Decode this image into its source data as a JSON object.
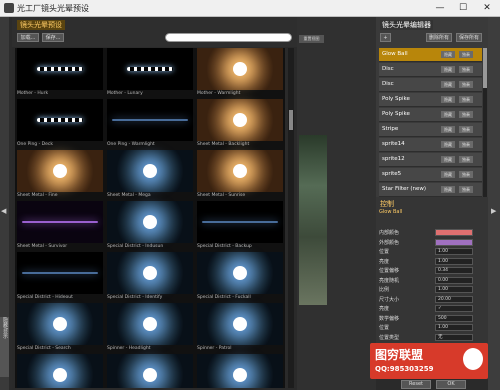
{
  "window": {
    "title": "光工厂镜头光晕预设",
    "min": "—",
    "max": "☐",
    "close": "✕"
  },
  "library": {
    "title": "镜头光晕预设",
    "buttons": [
      "加载...",
      "保存..."
    ],
    "collapse_btn": "隐藏/显示"
  },
  "presets": [
    {
      "name": "Mother - Hurk",
      "kind": "dots"
    },
    {
      "name": "Mother - Lunary",
      "kind": "dots"
    },
    {
      "name": "Mother - Warmlight",
      "kind": "glow-warm"
    },
    {
      "name": "One Ping - Deck",
      "kind": "dots"
    },
    {
      "name": "One Ping - Warmlight",
      "kind": "streak-blue"
    },
    {
      "name": "Sheet Metal - Backlight",
      "kind": "glow-warm"
    },
    {
      "name": "Sheet Metal - Fine",
      "kind": "glow-warm"
    },
    {
      "name": "Sheet Metal - Mega",
      "kind": "glow-blue"
    },
    {
      "name": "Sheet Metal - Sunrise",
      "kind": "glow-warm"
    },
    {
      "name": "Sheet Metal - Survivor",
      "kind": "streak-purple"
    },
    {
      "name": "Special District - Indusun",
      "kind": "glow-blue"
    },
    {
      "name": "Special District - Backup",
      "kind": "streak-blue"
    },
    {
      "name": "Special District - Hideout",
      "kind": "streak-blue"
    },
    {
      "name": "Special District - Identify",
      "kind": "glow-blue"
    },
    {
      "name": "Special District - Fuckall",
      "kind": "glow-blue"
    },
    {
      "name": "Special District - Search",
      "kind": "glow-blue"
    },
    {
      "name": "Spinner - Headlight",
      "kind": "glow-blue"
    },
    {
      "name": "Spinner - Patrol",
      "kind": "glow-blue"
    },
    {
      "name": "",
      "kind": "glow-blue"
    },
    {
      "name": "",
      "kind": "glow-blue"
    },
    {
      "name": "",
      "kind": "glow-blue"
    }
  ],
  "editor": {
    "title": "镜头光晕编辑器",
    "add_btn": "+",
    "delete_all": "删除所有",
    "save_all": "保存所有",
    "items": [
      {
        "name": "Glow Ball",
        "selected": true
      },
      {
        "name": "Disc",
        "selected": false
      },
      {
        "name": "Disc",
        "selected": false
      },
      {
        "name": "Poly Spike",
        "selected": false
      },
      {
        "name": "Poly Spike",
        "selected": false
      },
      {
        "name": "Stripe",
        "selected": false
      },
      {
        "name": "sprite14",
        "selected": false
      },
      {
        "name": "sprite12",
        "selected": false
      },
      {
        "name": "sprite5",
        "selected": false
      },
      {
        "name": "Star Filter (new)",
        "selected": false
      }
    ],
    "item_btn1": "隐藏",
    "item_btn2": "独奏"
  },
  "control": {
    "title": "控制",
    "selected_name": "Glow Ball",
    "rows": [
      {
        "label": "内部颜色",
        "value": "",
        "swatch": "#e07070"
      },
      {
        "label": "外部颜色",
        "value": "",
        "swatch": "#a070c0"
      },
      {
        "label": "位置",
        "value": "1.00"
      },
      {
        "label": "亮度",
        "value": "1.00"
      },
      {
        "label": "位置偏移",
        "value": "0.34"
      },
      {
        "label": "亮度随机",
        "value": "0.00"
      },
      {
        "label": "比例",
        "value": "1.00"
      },
      {
        "label": "尺寸大小",
        "value": "20.00"
      },
      {
        "label": "亮度",
        "value": "✓"
      },
      {
        "label": "数学偏移",
        "value": "500"
      },
      {
        "label": "位置",
        "value": "1.00"
      },
      {
        "label": "位置类型",
        "value": "无"
      },
      {
        "label": "亮度偏移",
        "value": ""
      }
    ]
  },
  "footer": {
    "reset": "Reset",
    "ok": "OK"
  },
  "watermark": {
    "line1": "图穷联盟",
    "line2": "QQ:985303259"
  }
}
